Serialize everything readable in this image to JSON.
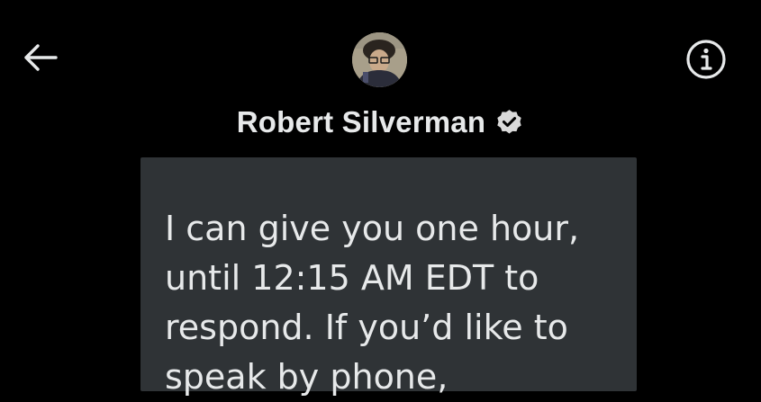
{
  "header": {
    "back_icon": "arrow-left-icon",
    "info_icon": "info-circle-icon",
    "avatar_icon": "user-avatar",
    "contact_name": "Robert Silverman",
    "verified_icon": "verified-badge-icon"
  },
  "conversation": {
    "message_text": "I can give you one hour,\nuntil 12:15 AM EDT to\nrespond. If you’d like to\nspeak by phone,"
  },
  "colors": {
    "background": "#000000",
    "text": "#e7e9ea",
    "bubble": "#2f3336"
  }
}
